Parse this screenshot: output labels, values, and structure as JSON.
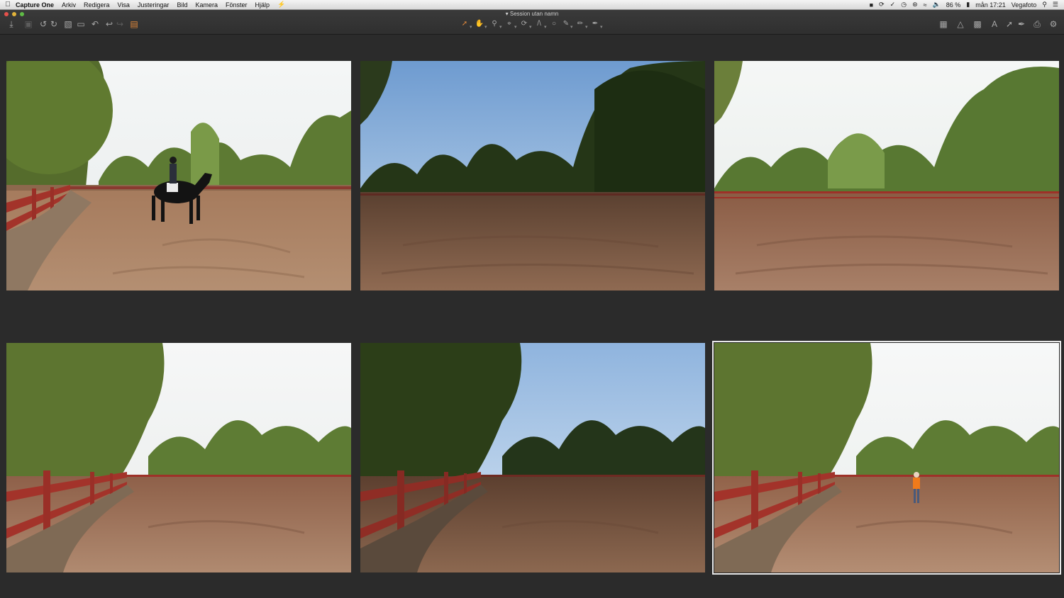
{
  "menubar": {
    "apple": "",
    "app_name": "Capture One",
    "items": [
      "Arkiv",
      "Redigera",
      "Visa",
      "Justeringar",
      "Bild",
      "Kamera",
      "Fönster",
      "Hjälp"
    ],
    "battery": "86 %",
    "clock": "mån 17:21",
    "user": "Vegafoto"
  },
  "window": {
    "title": "Session utan namn"
  },
  "toolbar": {
    "left_tools": [
      "import-icon",
      "camera-icon",
      "rotate-left-icon",
      "rotate-right-icon",
      "folder-icon",
      "trash-icon",
      "reset-icon",
      "undo-icon",
      "redo-icon",
      "stack-icon"
    ],
    "center_tools": [
      "select-cursor-icon",
      "pan-hand-icon",
      "zoom-icon",
      "crop-icon",
      "rotate-icon",
      "keystone-icon",
      "circle-mask-icon",
      "brush-icon",
      "eraser-icon",
      "picker-icon"
    ],
    "right_tools": [
      "grid-view-icon",
      "warning-icon",
      "grid-overlay-icon",
      "text-icon",
      "export-icon",
      "edit-icon",
      "print-icon",
      "settings-icon"
    ]
  },
  "colors": {
    "background": "#2b2b2b",
    "accent_selected": "#e8e8e8",
    "active_tool": "#e0883b"
  },
  "images": [
    {
      "scene": "rider-on-horse",
      "fence_left": false,
      "selected": false
    },
    {
      "scene": "empty-arena-dark",
      "fence_left": false,
      "selected": false
    },
    {
      "scene": "empty-arena",
      "fence_left": false,
      "selected": false
    },
    {
      "scene": "fence-tree-left",
      "fence_left": true,
      "selected": false
    },
    {
      "scene": "fence-tree-left-dark",
      "fence_left": true,
      "selected": false
    },
    {
      "scene": "fence-tree-person",
      "fence_left": true,
      "selected": true
    }
  ]
}
